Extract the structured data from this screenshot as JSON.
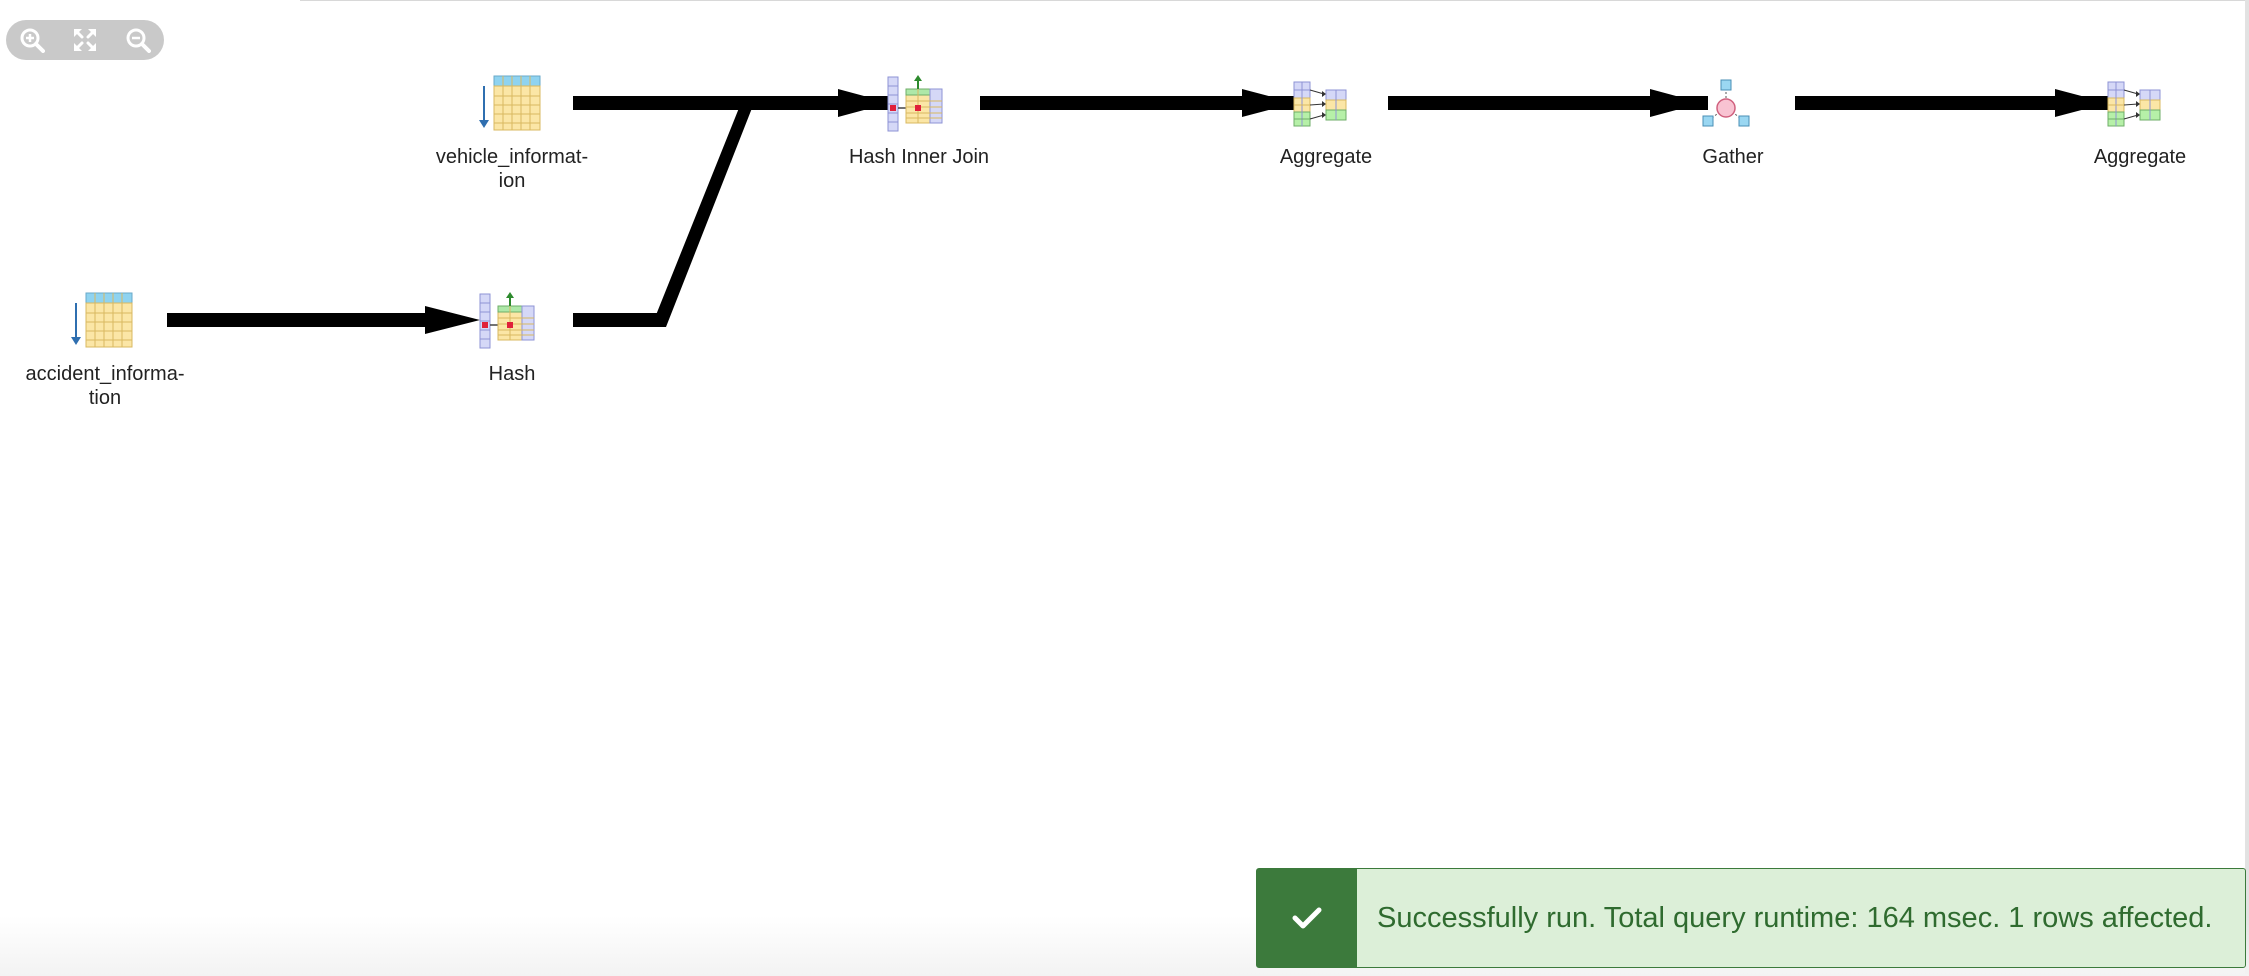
{
  "zoom_controls": {
    "zoom_in": "zoom-in-icon",
    "fit": "fit-to-screen-icon",
    "zoom_out": "zoom-out-icon"
  },
  "nodes": [
    {
      "id": "vehicle",
      "label": "vehicle_informat-\nion",
      "icon": "table-scan-icon"
    },
    {
      "id": "accident",
      "label": "accident_informa-\ntion",
      "icon": "table-scan-icon"
    },
    {
      "id": "hash",
      "label": "Hash",
      "icon": "hash-icon"
    },
    {
      "id": "join",
      "label": "Hash Inner Join",
      "icon": "hash-join-icon"
    },
    {
      "id": "agg1",
      "label": "Aggregate",
      "icon": "aggregate-icon"
    },
    {
      "id": "gather",
      "label": "Gather",
      "icon": "gather-icon"
    },
    {
      "id": "agg2",
      "label": "Aggregate",
      "icon": "aggregate-icon"
    }
  ],
  "toast": {
    "message": "Successfully run. Total query runtime: 164 msec. 1 rows affected.",
    "icon": "check-icon",
    "color_bg": "#dcefd8",
    "color_accent": "#3c7a3c"
  }
}
